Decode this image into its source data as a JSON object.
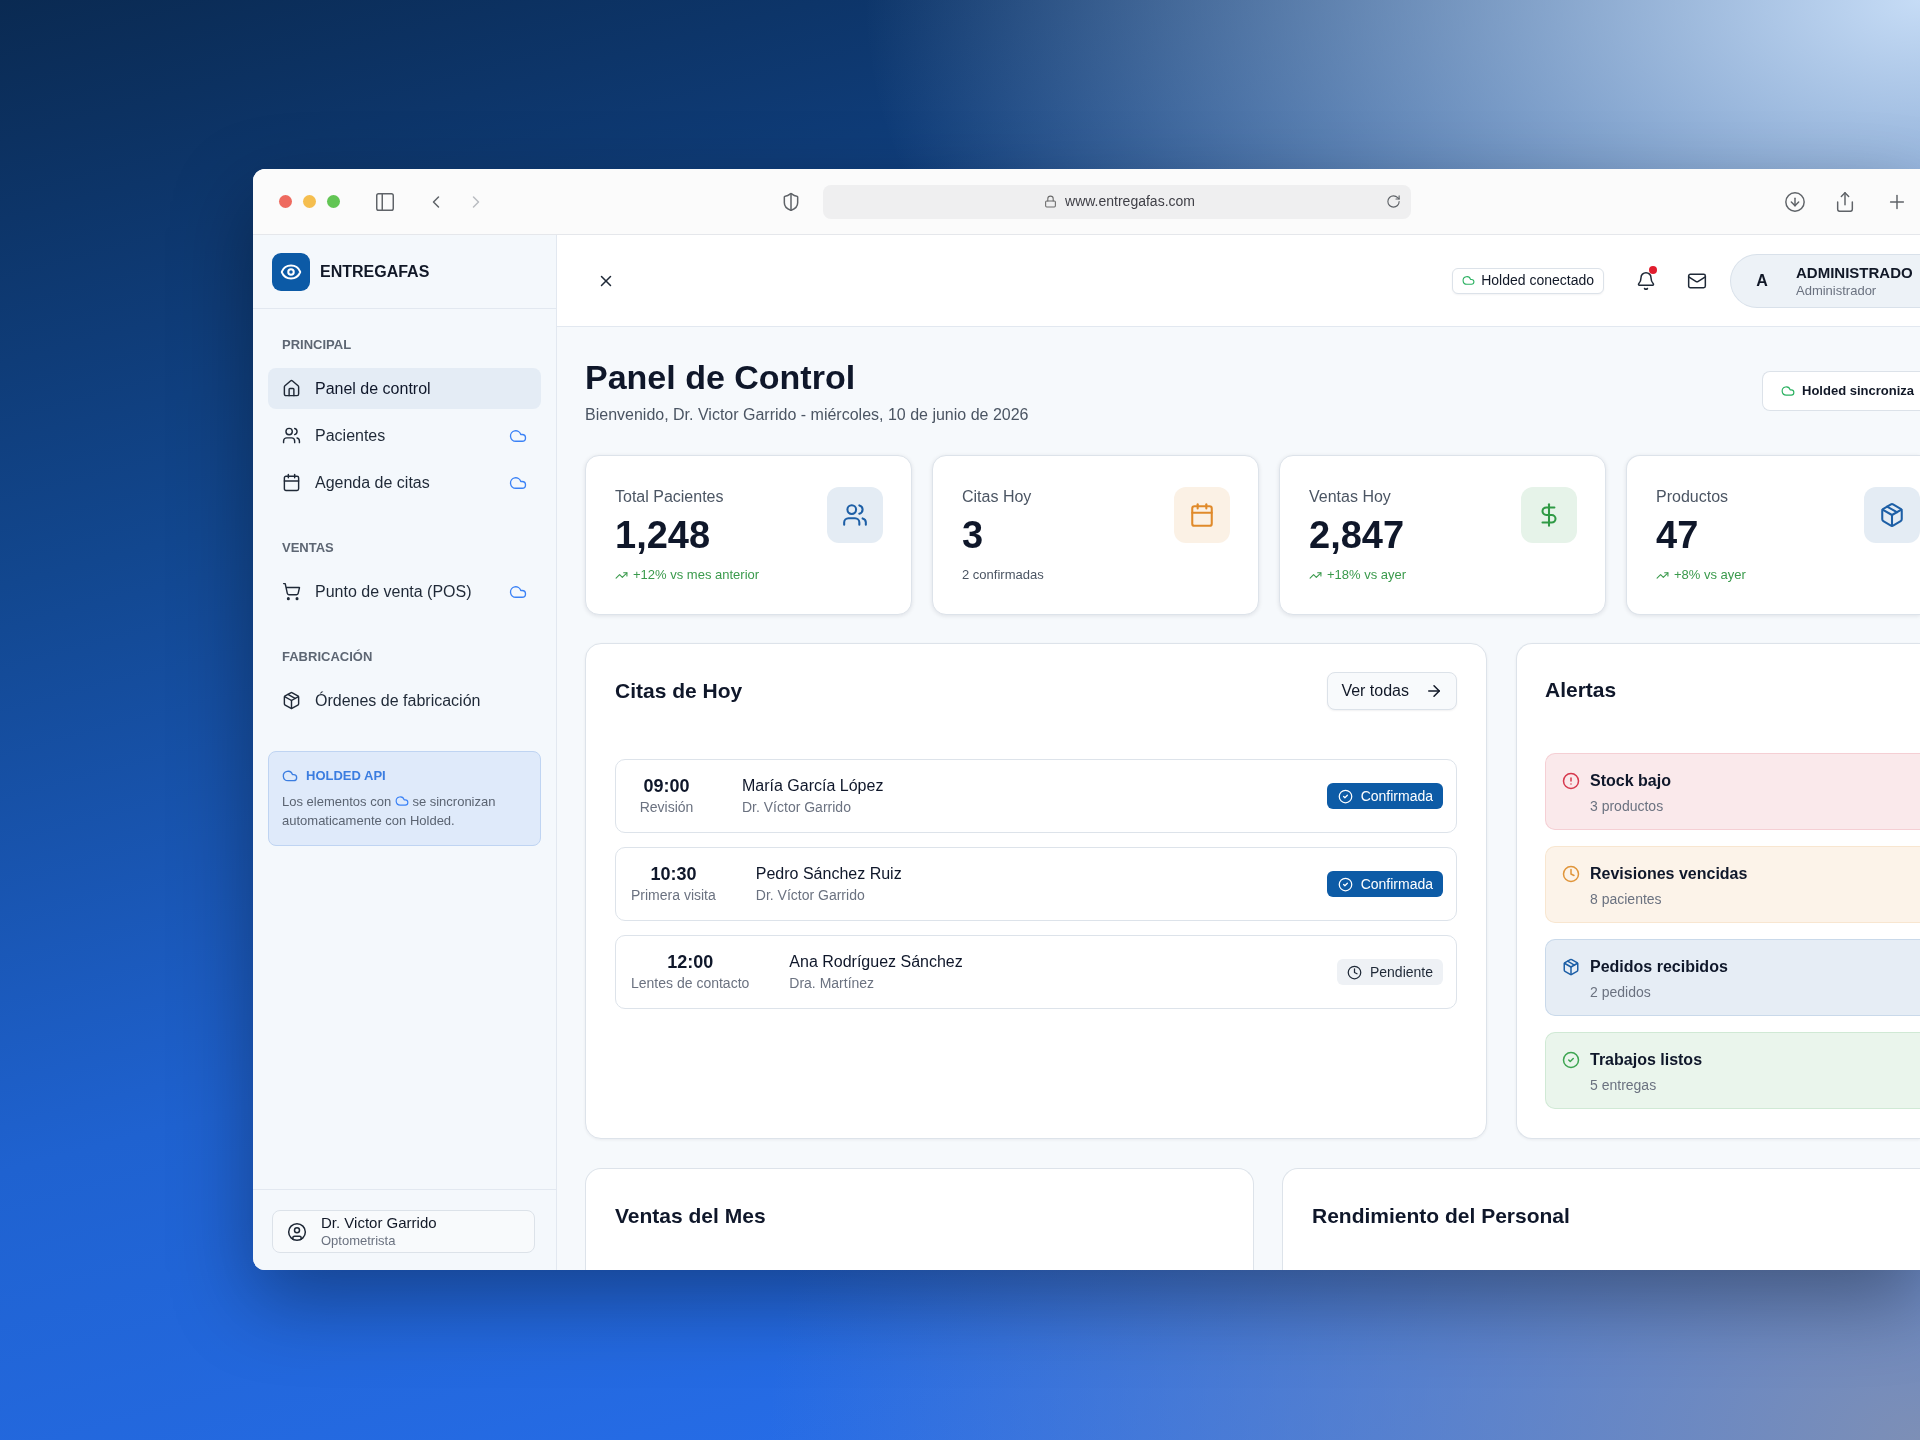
{
  "browser": {
    "url": "www.entregafas.com"
  },
  "sidebar": {
    "brand": "ENTREGAFAS",
    "sections": [
      {
        "title": "PRINCIPAL",
        "items": [
          {
            "label": "Panel de control",
            "selected": true,
            "synced": false
          },
          {
            "label": "Pacientes",
            "selected": false,
            "synced": true
          },
          {
            "label": "Agenda de citas",
            "selected": false,
            "synced": true
          }
        ]
      },
      {
        "title": "VENTAS",
        "items": [
          {
            "label": "Punto de venta (POS)",
            "selected": false,
            "synced": true
          }
        ]
      },
      {
        "title": "FABRICACIÓN",
        "items": [
          {
            "label": "Órdenes de fabricación",
            "selected": false,
            "synced": false
          }
        ]
      }
    ],
    "sync_card": {
      "title": "HOLDED API",
      "note_before": "Los elementos con",
      "note_after": "se sincronizan automaticamente con Holded."
    },
    "user": {
      "name": "Dr. Victor Garrido",
      "role": "Optometrista"
    }
  },
  "header": {
    "connection": "Holded conectado",
    "notifications_unread": true,
    "account": {
      "initial": "A",
      "name": "ADMINISTRADO",
      "role": "Administrador"
    }
  },
  "page": {
    "title": "Panel de Control",
    "subtitle": "Bienvenido, Dr. Victor Garrido - miércoles, 10 de junio de 2026",
    "sync_button": "Holded sincroniza"
  },
  "stats": [
    {
      "label": "Total Pacientes",
      "value": "1,248",
      "note": "+12% vs mes anterior",
      "kind": "trend",
      "color": "#1d5fa6"
    },
    {
      "label": "Citas Hoy",
      "value": "3",
      "note": "2 confirmadas",
      "kind": "plain",
      "color": "#e08a2a"
    },
    {
      "label": "Ventas Hoy",
      "value": "2,847",
      "note": "+18% vs ayer",
      "kind": "trend",
      "color": "#2f9a45"
    },
    {
      "label": "Productos",
      "value": "47",
      "note": "+8% vs ayer",
      "kind": "trend",
      "color": "#1d5fa6"
    }
  ],
  "appointments": {
    "title": "Citas de Hoy",
    "action": "Ver todas",
    "rows": [
      {
        "time": "09:00",
        "type": "Revisión",
        "patient": "María García López",
        "doctor": "Dr. Víctor Garrido",
        "status": {
          "label": "Confirmada",
          "kind": "confirmed"
        }
      },
      {
        "time": "10:30",
        "type": "Primera visita",
        "patient": "Pedro Sánchez Ruiz",
        "doctor": "Dr. Víctor Garrido",
        "status": {
          "label": "Confirmada",
          "kind": "confirmed"
        }
      },
      {
        "time": "12:00",
        "type": "Lentes de contacto",
        "patient": "Ana Rodríguez Sánchez",
        "doctor": "Dra. Martínez",
        "status": {
          "label": "Pendiente",
          "kind": "pending"
        }
      }
    ]
  },
  "alerts": {
    "title": "Alertas",
    "items": [
      {
        "title": "Stock bajo",
        "detail": "3 productos",
        "color": "#d6384d"
      },
      {
        "title": "Revisiones vencidas",
        "detail": "8 pacientes",
        "color": "#e0953a"
      },
      {
        "title": "Pedidos recibidos",
        "detail": "2 pedidos",
        "color": "#1d5fa6"
      },
      {
        "title": "Trabajos listos",
        "detail": "5 entregas",
        "color": "#3da551"
      }
    ]
  },
  "panels": [
    {
      "title": "Ventas del Mes"
    },
    {
      "title": "Rendimiento del Personal"
    }
  ]
}
